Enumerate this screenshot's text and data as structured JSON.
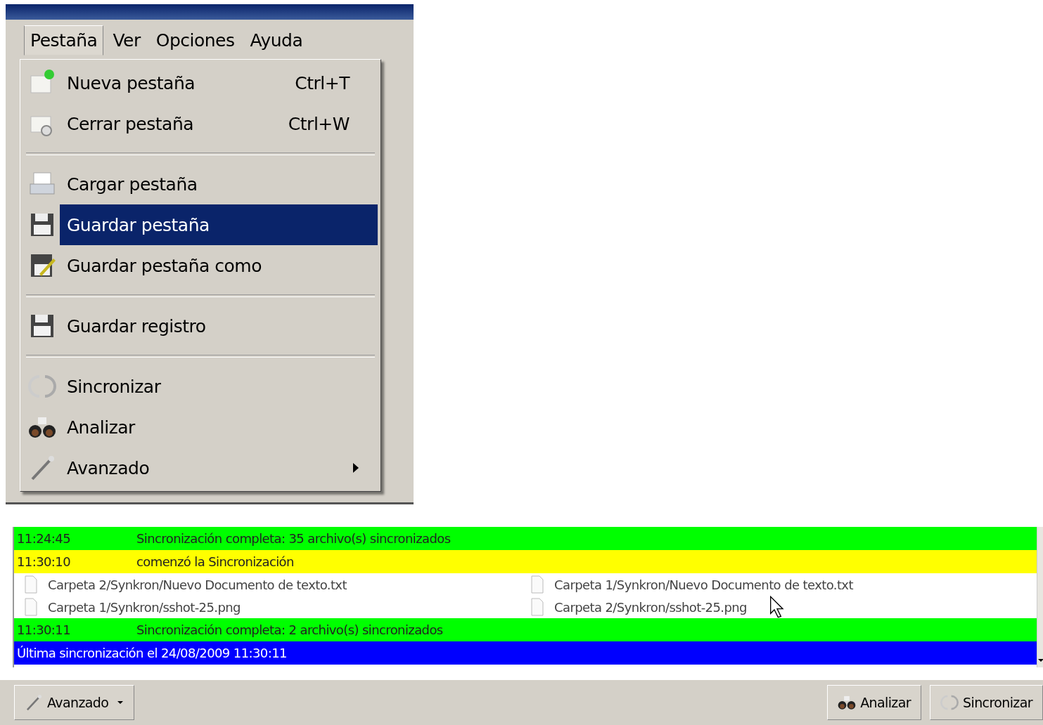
{
  "menu_bar": [
    {
      "label": "Pestaña",
      "selected": true
    },
    {
      "label": "Ver",
      "selected": false
    },
    {
      "label": "Opciones",
      "selected": false
    },
    {
      "label": "Ayuda",
      "selected": false
    }
  ],
  "menu": [
    {
      "kind": "item",
      "label": "Nueva pestaña",
      "shortcut": "Ctrl+T",
      "selected": false,
      "submenu": false
    },
    {
      "kind": "item",
      "label": "Cerrar pestaña",
      "shortcut": "Ctrl+W",
      "selected": false,
      "submenu": false
    },
    {
      "kind": "separator"
    },
    {
      "kind": "item",
      "label": "Cargar pestaña",
      "selected": false,
      "submenu": false
    },
    {
      "kind": "item",
      "label": "Guardar pestaña",
      "selected": true,
      "submenu": false
    },
    {
      "kind": "item",
      "label": "Guardar pestaña como",
      "selected": false,
      "submenu": false
    },
    {
      "kind": "separator"
    },
    {
      "kind": "item",
      "label": "Guardar registro",
      "selected": false,
      "submenu": false
    },
    {
      "kind": "separator"
    },
    {
      "kind": "item",
      "label": "Sincronizar",
      "selected": false,
      "submenu": false
    },
    {
      "kind": "item",
      "label": "Analizar",
      "selected": false,
      "submenu": false
    },
    {
      "kind": "item",
      "label": "Avanzado",
      "selected": false,
      "submenu": true
    }
  ],
  "log": [
    {
      "kind": "status",
      "time": "11:24:45",
      "message": "Sincronización completa: 35 archivo(s) sincronizados",
      "color": "#00ff00"
    },
    {
      "kind": "status",
      "time": "11:30:10",
      "message": "comenzó la Sincronización",
      "color": "#ffff00"
    },
    {
      "kind": "file",
      "left": "Carpeta 2/Synkron/Nuevo Documento de texto.txt",
      "right": "Carpeta 1/Synkron/Nuevo Documento de texto.txt"
    },
    {
      "kind": "file",
      "left": "Carpeta 1/Synkron/sshot-25.png",
      "right": "Carpeta 2/Synkron/sshot-25.png"
    },
    {
      "kind": "status",
      "time": "11:30:11",
      "message": "Sincronización completa: 2 archivo(s) sincronizados",
      "color": "#00ff00"
    },
    {
      "kind": "info",
      "message": "Última sincronización el 24/08/2009 11:30:11",
      "color": "#0000ff"
    }
  ],
  "buttons": [
    {
      "label": "Avanzado",
      "dropdown": true
    },
    {
      "label": "Analizar",
      "dropdown": false
    },
    {
      "label": "Sincronizar",
      "dropdown": false
    }
  ]
}
